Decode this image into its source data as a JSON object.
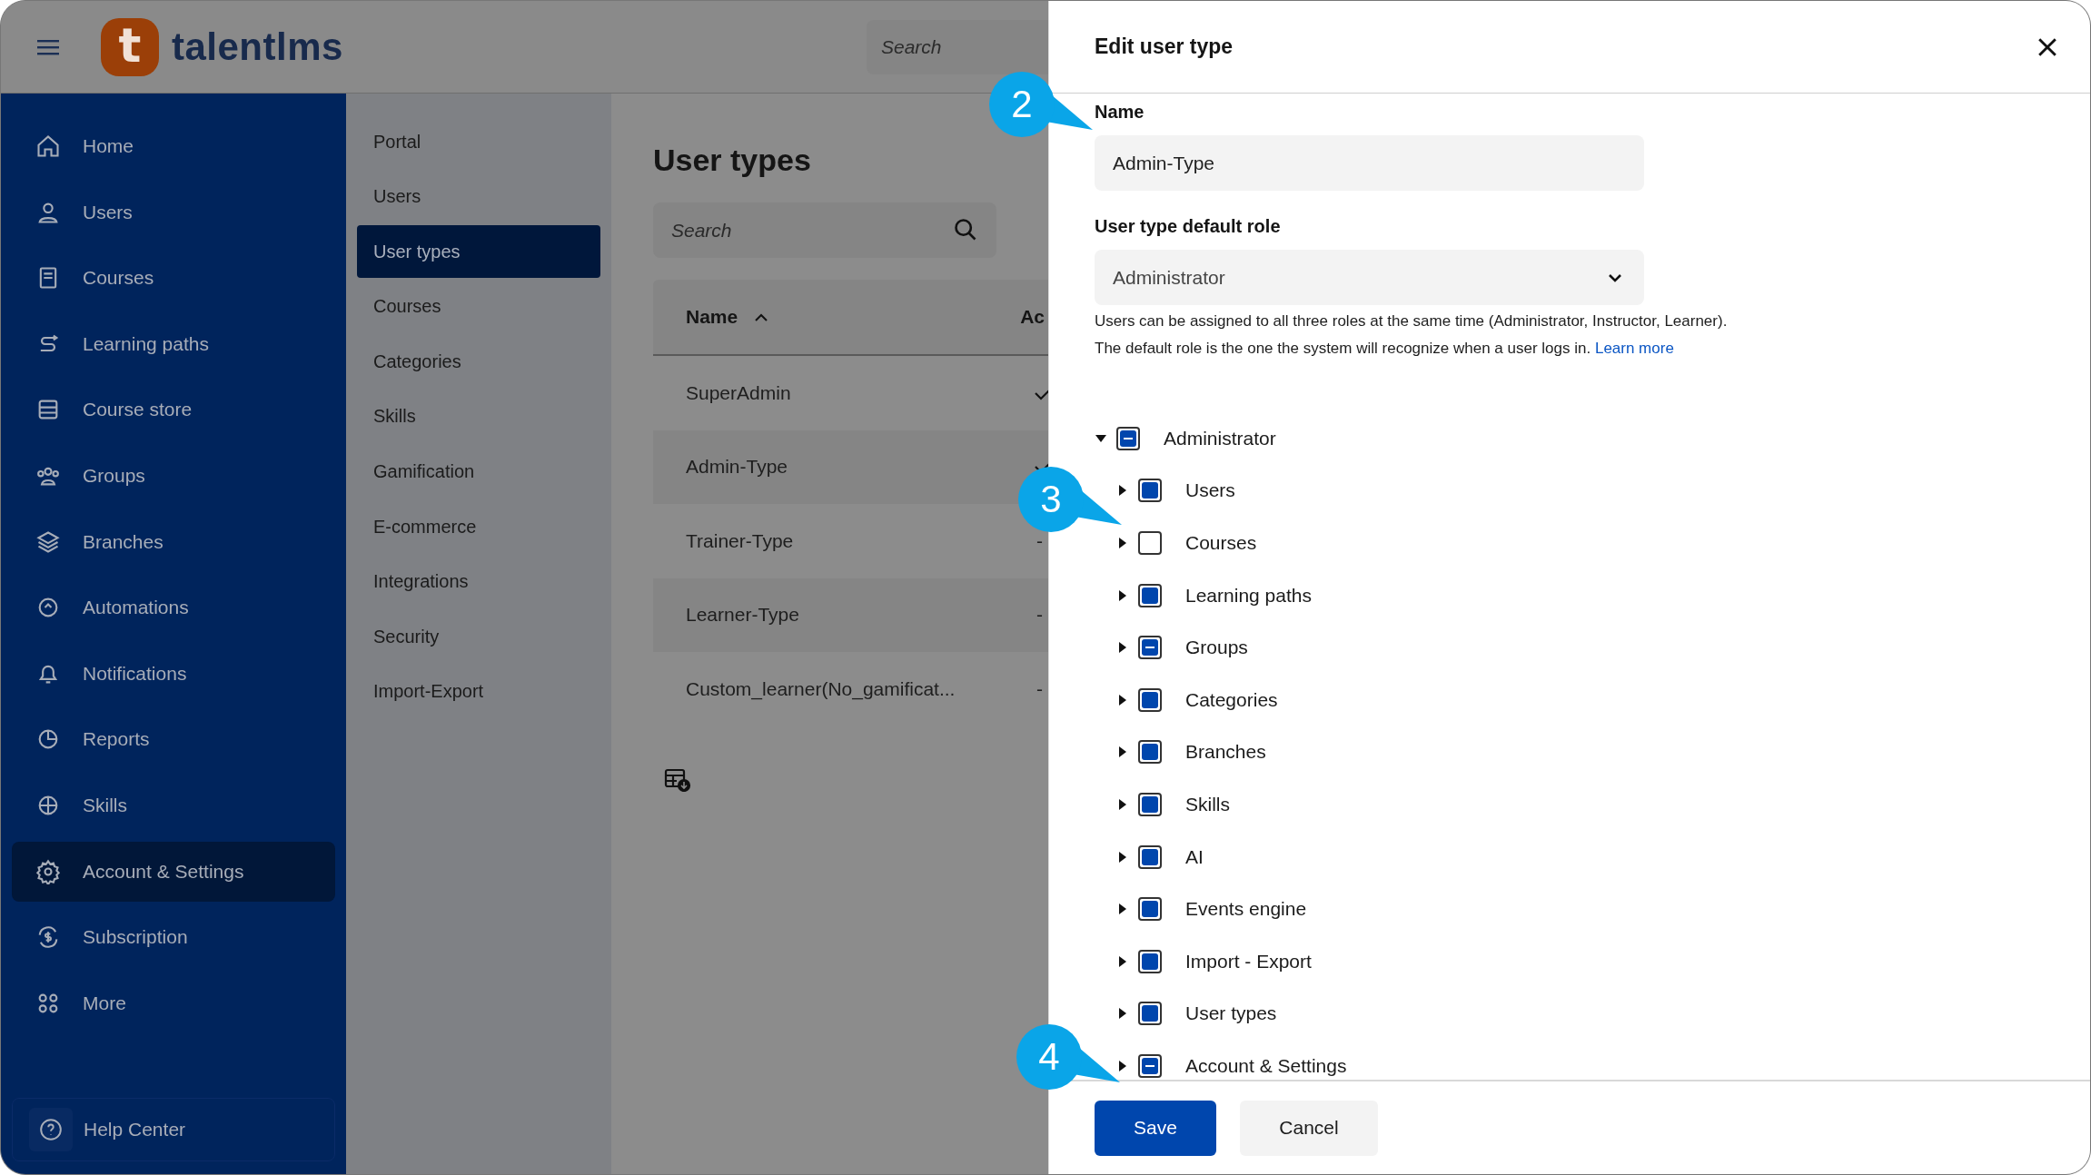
{
  "top_bar": {
    "logo_letter": "t",
    "logo_text": "talentlms",
    "search": {
      "placeholder": "Search"
    }
  },
  "sidebar": {
    "items": [
      {
        "label": "Home",
        "selected": false
      },
      {
        "label": "Users",
        "selected": false
      },
      {
        "label": "Courses",
        "selected": false
      },
      {
        "label": "Learning paths",
        "selected": false
      },
      {
        "label": "Course store",
        "selected": false
      },
      {
        "label": "Groups",
        "selected": false
      },
      {
        "label": "Branches",
        "selected": false
      },
      {
        "label": "Automations",
        "selected": false
      },
      {
        "label": "Notifications",
        "selected": false
      },
      {
        "label": "Reports",
        "selected": false
      },
      {
        "label": "Skills",
        "selected": false
      },
      {
        "label": "Account & Settings",
        "selected": true
      },
      {
        "label": "Subscription",
        "selected": false
      },
      {
        "label": "More",
        "selected": false
      }
    ],
    "help": "Help Center"
  },
  "settings_nav": {
    "items": [
      {
        "label": "Portal",
        "selected": false
      },
      {
        "label": "Users",
        "selected": false
      },
      {
        "label": "User types",
        "selected": true
      },
      {
        "label": "Courses",
        "selected": false
      },
      {
        "label": "Categories",
        "selected": false
      },
      {
        "label": "Skills",
        "selected": false
      },
      {
        "label": "Gamification",
        "selected": false
      },
      {
        "label": "E-commerce",
        "selected": false
      },
      {
        "label": "Integrations",
        "selected": false
      },
      {
        "label": "Security",
        "selected": false
      },
      {
        "label": "Import-Export",
        "selected": false
      }
    ]
  },
  "main": {
    "title": "User types",
    "search": {
      "placeholder": "Search"
    },
    "table": {
      "columns": [
        "Name",
        "Ac"
      ],
      "rows": [
        {
          "name": "SuperAdmin",
          "kind": "check"
        },
        {
          "name": "Admin-Type",
          "kind": "check"
        },
        {
          "name": "Trainer-Type",
          "kind": "text",
          "column_2": "-"
        },
        {
          "name": "Learner-Type",
          "kind": "text",
          "column_2": "-"
        },
        {
          "name": "Custom_learner(No_gamificat...",
          "kind": "text",
          "column_2": "-"
        }
      ]
    }
  },
  "panel": {
    "title": "Edit user type",
    "name_label": "Name",
    "name_value": "Admin-Type",
    "role_label": "User type default role",
    "role_value": "Administrator",
    "help_lines": [
      "Users can be assigned to all three roles at the same time (Administrator, Instructor, Learner).",
      "The default role is the one the system will recognize when a user logs in."
    ],
    "learn_more": "Learn more",
    "tree": [
      {
        "label": "Administrator",
        "expanded": true,
        "checked": true,
        "partial": true,
        "children": [
          {
            "label": "Users",
            "expanded": false,
            "checked": true,
            "partial": false
          },
          {
            "label": "Courses",
            "expanded": false,
            "checked": false,
            "partial": false
          },
          {
            "label": "Learning paths",
            "expanded": false,
            "checked": true,
            "partial": false
          },
          {
            "label": "Groups",
            "expanded": false,
            "checked": true,
            "partial": true
          },
          {
            "label": "Categories",
            "expanded": false,
            "checked": true,
            "partial": false
          },
          {
            "label": "Branches",
            "expanded": false,
            "checked": true,
            "partial": false
          },
          {
            "label": "Skills",
            "expanded": false,
            "checked": true,
            "partial": false
          },
          {
            "label": "AI",
            "expanded": false,
            "checked": true,
            "partial": false
          },
          {
            "label": "Events engine",
            "expanded": false,
            "checked": true,
            "partial": false
          },
          {
            "label": "Import - Export",
            "expanded": false,
            "checked": true,
            "partial": false
          },
          {
            "label": "User types",
            "expanded": false,
            "checked": true,
            "partial": false
          },
          {
            "label": "Account & Settings",
            "expanded": false,
            "checked": true,
            "partial": true
          }
        ]
      }
    ],
    "buttons": [
      "Save",
      "Cancel"
    ]
  },
  "callouts": [
    "2",
    "3",
    "4"
  ]
}
